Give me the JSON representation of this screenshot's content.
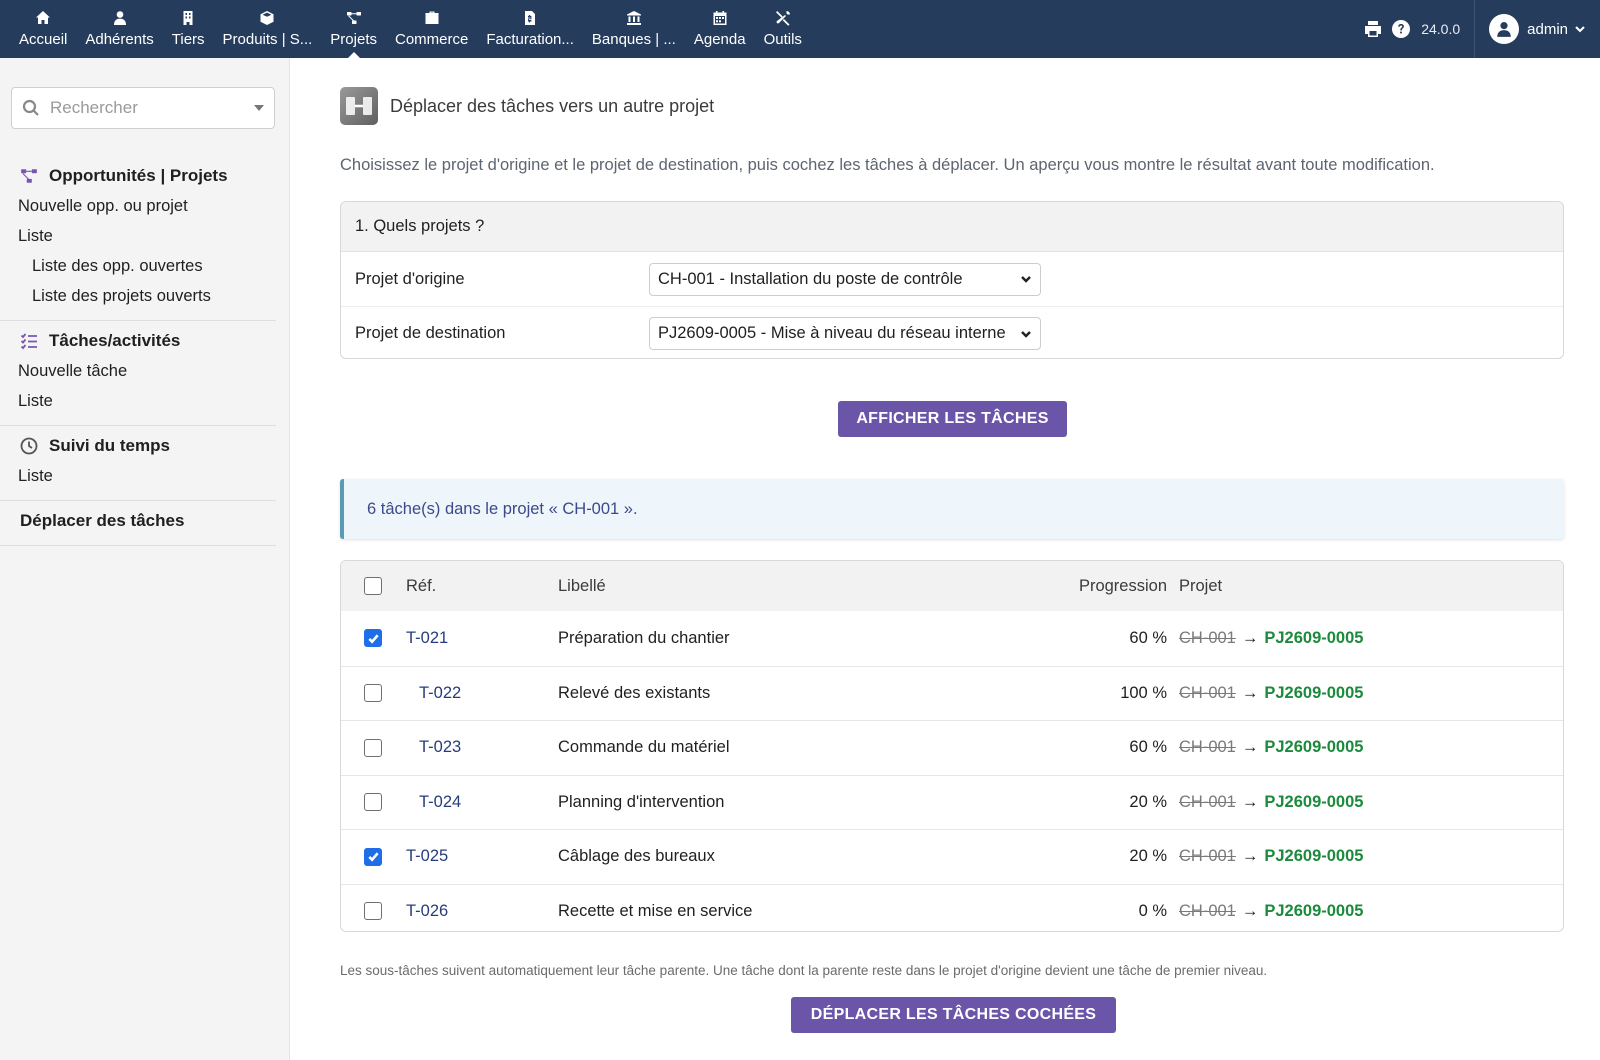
{
  "topbar": {
    "menu": [
      {
        "label": "Accueil",
        "icon": "home-icon"
      },
      {
        "label": "Adhérents",
        "icon": "member-icon"
      },
      {
        "label": "Tiers",
        "icon": "building-icon"
      },
      {
        "label": "Produits | S...",
        "icon": "box-icon"
      },
      {
        "label": "Projets",
        "icon": "project-icon",
        "active": true
      },
      {
        "label": "Commerce",
        "icon": "briefcase-icon"
      },
      {
        "label": "Facturation...",
        "icon": "invoice-icon"
      },
      {
        "label": "Banques | ...",
        "icon": "bank-icon"
      },
      {
        "label": "Agenda",
        "icon": "calendar-icon"
      },
      {
        "label": "Outils",
        "icon": "tools-icon"
      }
    ],
    "version": "24.0.0",
    "user": "admin"
  },
  "sidebar": {
    "search_placeholder": "Rechercher",
    "groups": [
      {
        "title": "Opportunités | Projets",
        "icon": "project-icon",
        "links": [
          {
            "label": "Nouvelle opp. ou projet",
            "sub": false
          },
          {
            "label": "Liste",
            "sub": false
          },
          {
            "label": "Liste des opp. ouvertes",
            "sub": true
          },
          {
            "label": "Liste des projets ouverts",
            "sub": true
          }
        ]
      },
      {
        "title": "Tâches/activités",
        "icon": "task-list-icon",
        "links": [
          {
            "label": "Nouvelle tâche",
            "sub": false
          },
          {
            "label": "Liste",
            "sub": false
          }
        ]
      },
      {
        "title": "Suivi du temps",
        "icon": "clock-icon",
        "links": [
          {
            "label": "Liste",
            "sub": false
          }
        ]
      },
      {
        "title": "Déplacer des tâches",
        "icon": "",
        "links": []
      }
    ]
  },
  "main": {
    "title": "Déplacer des tâches vers un autre projet",
    "intro": "Choisissez le projet d'origine et le projet de destination, puis cochez les tâches à déplacer. Un aperçu vous montre le résultat avant toute modification.",
    "step1_title": "1. Quels projets ?",
    "origin_label": "Projet d'origine",
    "origin_value": "CH-001 - Installation du poste de contrôle",
    "dest_label": "Projet de destination",
    "dest_value": "PJ2609-0005 - Mise à niveau du réseau interne",
    "show_button": "AFFICHER LES TÂCHES",
    "info": "6 tâche(s) dans le projet « CH-001 ».",
    "table": {
      "headers": {
        "ref": "Réf.",
        "label": "Libellé",
        "progress": "Progression",
        "project": "Projet"
      },
      "rows": [
        {
          "checked": true,
          "indent": false,
          "ref": "T-021",
          "label": "Préparation du chantier",
          "progress": "60 %",
          "from": "CH-001",
          "to": "PJ2609-0005"
        },
        {
          "checked": false,
          "indent": true,
          "ref": "T-022",
          "label": "Relevé des existants",
          "progress": "100 %",
          "from": "CH-001",
          "to": "PJ2609-0005"
        },
        {
          "checked": false,
          "indent": true,
          "ref": "T-023",
          "label": "Commande du matériel",
          "progress": "60 %",
          "from": "CH-001",
          "to": "PJ2609-0005"
        },
        {
          "checked": false,
          "indent": true,
          "ref": "T-024",
          "label": "Planning d'intervention",
          "progress": "20 %",
          "from": "CH-001",
          "to": "PJ2609-0005"
        },
        {
          "checked": true,
          "indent": false,
          "ref": "T-025",
          "label": "Câblage des bureaux",
          "progress": "20 %",
          "from": "CH-001",
          "to": "PJ2609-0005"
        },
        {
          "checked": false,
          "indent": false,
          "ref": "T-026",
          "label": "Recette et mise en service",
          "progress": "0 %",
          "from": "CH-001",
          "to": "PJ2609-0005"
        }
      ]
    },
    "note": "Les sous-tâches suivent automatiquement leur tâche parente. Une tâche dont la parente reste dans le projet d'origine devient une tâche de premier niveau.",
    "move_button": "DÉPLACER LES TÂCHES COCHÉES"
  }
}
